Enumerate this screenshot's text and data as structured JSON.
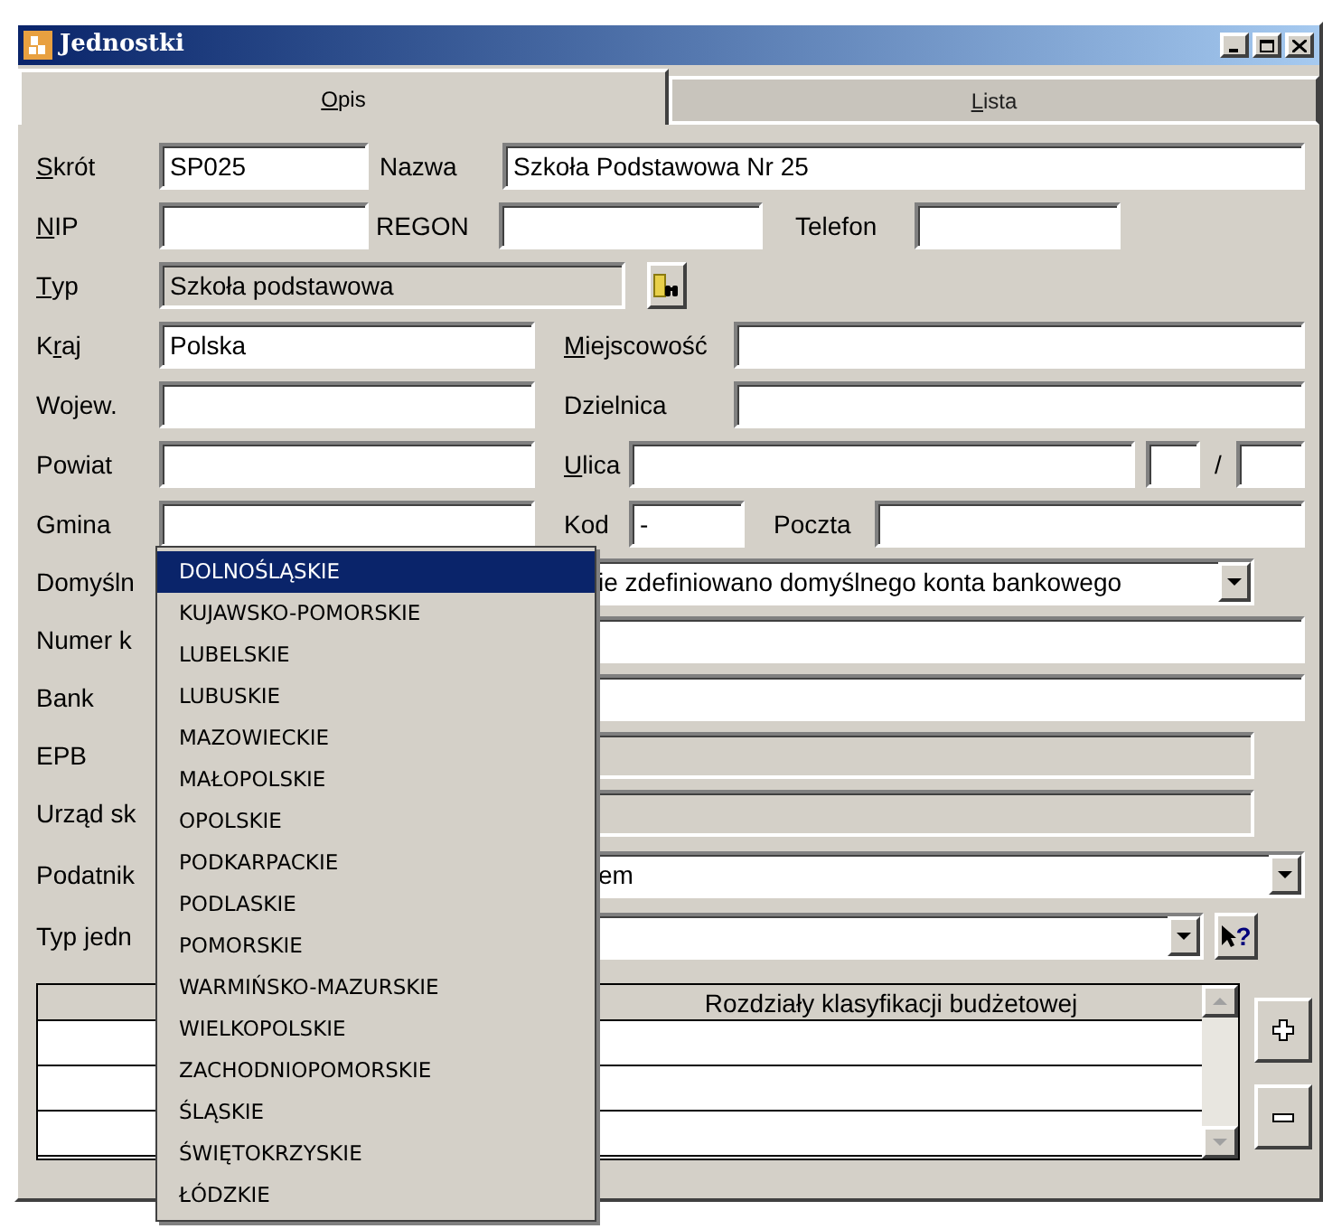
{
  "window": {
    "title": "Jednostki"
  },
  "tabs": [
    {
      "label": {
        "key": "O",
        "after": "pis"
      },
      "selected": true
    },
    {
      "label": {
        "key": "L",
        "after": "ista"
      },
      "selected": false
    }
  ],
  "rows": [
    {
      "items": [
        {
          "kind": "label",
          "text": {
            "key": "S",
            "after": "krót"
          }
        },
        {
          "kind": "field",
          "value": "SP025",
          "readonly": false
        },
        {
          "kind": "label",
          "text": "Nazwa"
        },
        {
          "kind": "field",
          "value": "Szkoła Podstawowa Nr 25",
          "readonly": false
        }
      ]
    },
    {
      "items": [
        {
          "kind": "label",
          "text": {
            "key": "N",
            "after": "IP"
          }
        },
        {
          "kind": "field",
          "readonly": false
        },
        {
          "kind": "label",
          "text": "REGON"
        },
        {
          "kind": "field",
          "readonly": false
        },
        {
          "kind": "label",
          "text": "Telefon"
        },
        {
          "kind": "field",
          "readonly": false
        }
      ]
    },
    {
      "items": [
        {
          "kind": "label",
          "text": {
            "key": "T",
            "after": "yp"
          }
        },
        {
          "kind": "field",
          "value": "Szkoła podstawowa",
          "readonly": true
        },
        {
          "kind": "lookup_button"
        }
      ]
    },
    {
      "items": [
        {
          "kind": "label",
          "text": {
            "before": "K",
            "key": "r",
            "after": "aj"
          }
        },
        {
          "kind": "field",
          "value": "Polska",
          "readonly": false
        },
        {
          "kind": "label",
          "text": {
            "key": "M",
            "after": "iejscowość"
          }
        },
        {
          "kind": "field",
          "readonly": false
        }
      ]
    },
    {
      "items": [
        {
          "kind": "label",
          "text": "Wojew."
        },
        {
          "kind": "field",
          "readonly": false
        },
        {
          "kind": "label",
          "text": "Dzielnica"
        },
        {
          "kind": "field",
          "readonly": false
        }
      ]
    },
    {
      "items": [
        {
          "kind": "label",
          "text": "Powiat"
        },
        {
          "kind": "field",
          "readonly": false
        },
        {
          "kind": "label",
          "text": {
            "key": "U",
            "after": "lica"
          }
        },
        {
          "kind": "field",
          "readonly": false
        },
        {
          "kind": "field",
          "readonly": false
        },
        {
          "kind": "label",
          "text": "/"
        },
        {
          "kind": "field",
          "readonly": false
        }
      ]
    },
    {
      "items": [
        {
          "kind": "label",
          "text": "Gmina"
        },
        {
          "kind": "field",
          "readonly": false
        },
        {
          "kind": "label",
          "text": "Kod"
        },
        {
          "kind": "field",
          "value": "-",
          "readonly": false
        },
        {
          "kind": "label",
          "text": "Poczta"
        },
        {
          "kind": "field",
          "readonly": false
        }
      ]
    },
    {
      "items": [
        {
          "kind": "label",
          "text": "Domyśln"
        },
        {
          "kind": "combo",
          "value": "ie zdefiniowano domyślnego konta bankowego"
        }
      ]
    },
    {
      "items": [
        {
          "kind": "label",
          "text": "Numer k"
        },
        {
          "kind": "field",
          "readonly": false
        }
      ]
    },
    {
      "items": [
        {
          "kind": "label",
          "text": "Bank"
        },
        {
          "kind": "field",
          "readonly": false
        }
      ]
    },
    {
      "items": [
        {
          "kind": "label",
          "text": "EPB"
        },
        {
          "kind": "field",
          "readonly": true
        }
      ]
    },
    {
      "items": [
        {
          "kind": "label",
          "text": "Urząd sk"
        },
        {
          "kind": "field",
          "readonly": true
        }
      ]
    },
    {
      "items": [
        {
          "kind": "label",
          "text": "Podatnik"
        },
        {
          "kind": "combo",
          "value": "em"
        }
      ]
    },
    {
      "items": [
        {
          "kind": "label",
          "text": "Typ jedn"
        },
        {
          "kind": "combo"
        },
        {
          "kind": "help_button",
          "glyph": "?"
        }
      ]
    }
  ],
  "table": {
    "columns": [
      {
        "label": "Rozdziały klasyfikacji budżetowej"
      }
    ]
  },
  "dropdown": {
    "items": [
      {
        "label": "DOLNOŚLĄSKIE",
        "selected": true
      },
      {
        "label": "KUJAWSKO-POMORSKIE",
        "selected": false
      },
      {
        "label": "LUBELSKIE",
        "selected": false
      },
      {
        "label": "LUBUSKIE",
        "selected": false
      },
      {
        "label": "MAZOWIECKIE",
        "selected": false
      },
      {
        "label": "MAŁOPOLSKIE",
        "selected": false
      },
      {
        "label": "OPOLSKIE",
        "selected": false
      },
      {
        "label": "PODKARPACKIE",
        "selected": false
      },
      {
        "label": "PODLASKIE",
        "selected": false
      },
      {
        "label": "POMORSKIE",
        "selected": false
      },
      {
        "label": "WARMIŃSKO-MAZURSKIE",
        "selected": false
      },
      {
        "label": "WIELKOPOLSKIE",
        "selected": false
      },
      {
        "label": "ZACHODNIOPOMORSKIE",
        "selected": false
      },
      {
        "label": "ŚLĄSKIE",
        "selected": false
      },
      {
        "label": "ŚWIĘTOKRZYSKIE",
        "selected": false
      },
      {
        "label": "ŁÓDZKIE",
        "selected": false
      }
    ]
  }
}
